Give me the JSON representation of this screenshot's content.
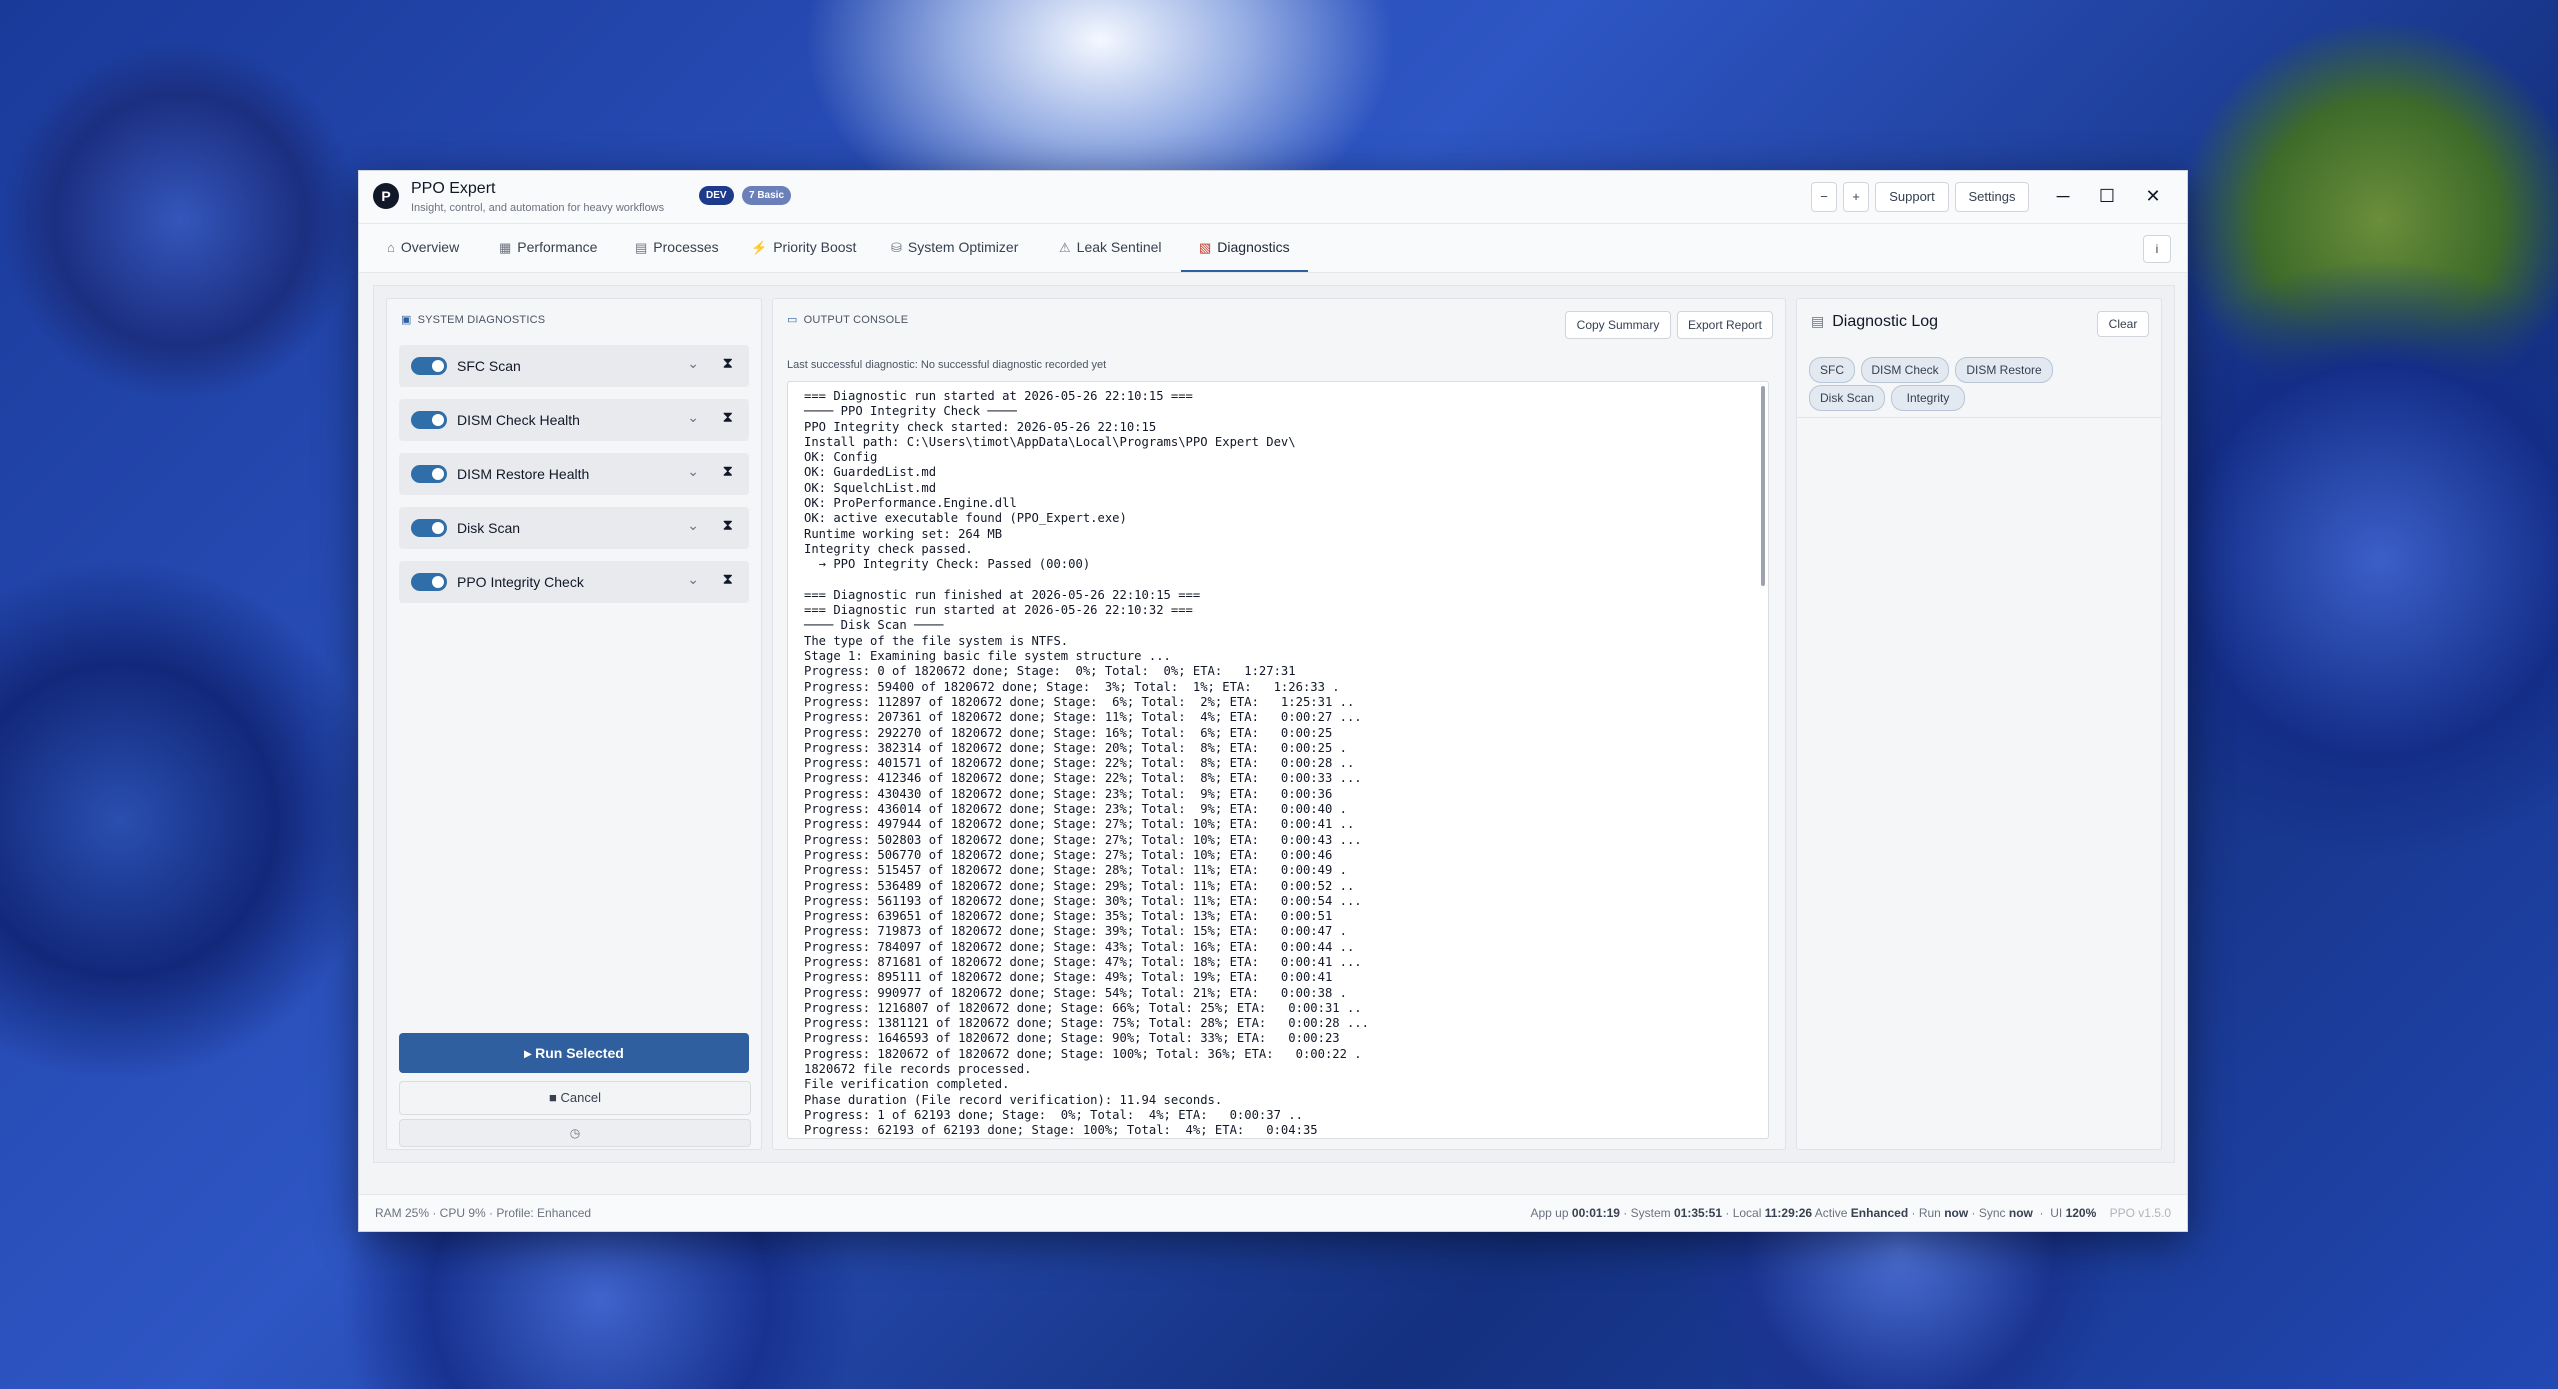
{
  "app": {
    "logo_letter": "P",
    "title": "PPO Expert",
    "subtitle": "Insight, control, and automation for heavy workflows",
    "badges": [
      "DEV",
      "7 Basic"
    ]
  },
  "titlebar": {
    "zoom_out": "−",
    "zoom_in": "+",
    "support": "Support",
    "settings": "Settings",
    "minimize": "─",
    "maximize": "☐",
    "close": "✕"
  },
  "tabs": [
    {
      "label": "Overview",
      "icon": "⌂"
    },
    {
      "label": "Performance",
      "icon": "▦"
    },
    {
      "label": "Processes",
      "icon": "▤"
    },
    {
      "label": "Priority Boost",
      "icon": "⚡"
    },
    {
      "label": "System Optimizer",
      "icon": "⛁"
    },
    {
      "label": "Leak Sentinel",
      "icon": "⚠"
    },
    {
      "label": "Diagnostics",
      "icon": "▧"
    }
  ],
  "info_label": "i",
  "left_panel": {
    "header": "SYSTEM DIAGNOSTICS",
    "items": [
      {
        "label": "SFC Scan",
        "enabled": true
      },
      {
        "label": "DISM Check Health",
        "enabled": true
      },
      {
        "label": "DISM Restore Health",
        "enabled": true
      },
      {
        "label": "Disk Scan",
        "enabled": true
      },
      {
        "label": "PPO Integrity Check",
        "enabled": true
      }
    ],
    "run_label": "▸  Run Selected",
    "cancel_label": "■  Cancel",
    "aux_label": "◷"
  },
  "console": {
    "header": "OUTPUT CONSOLE",
    "copy_label": "Copy Summary",
    "export_label": "Export Report",
    "last_diagnostic": "Last successful diagnostic: No successful diagnostic recorded yet",
    "lines": [
      "=== Diagnostic run started at 2026-05-26 22:10:15 ===",
      "──── PPO Integrity Check ────",
      "PPO Integrity check started: 2026-05-26 22:10:15",
      "Install path: C:\\Users\\timot\\AppData\\Local\\Programs\\PPO Expert Dev\\",
      "OK: Config",
      "OK: GuardedList.md",
      "OK: SquelchList.md",
      "OK: ProPerformance.Engine.dll",
      "OK: active executable found (PPO_Expert.exe)",
      "Runtime working set: 264 MB",
      "Integrity check passed.",
      "  → PPO Integrity Check: Passed (00:00)",
      "",
      "=== Diagnostic run finished at 2026-05-26 22:10:15 ===",
      "=== Diagnostic run started at 2026-05-26 22:10:32 ===",
      "──── Disk Scan ────",
      "The type of the file system is NTFS.",
      "Stage 1: Examining basic file system structure ...",
      "Progress: 0 of 1820672 done; Stage:  0%; Total:  0%; ETA:   1:27:31",
      "Progress: 59400 of 1820672 done; Stage:  3%; Total:  1%; ETA:   1:26:33 .",
      "Progress: 112897 of 1820672 done; Stage:  6%; Total:  2%; ETA:   1:25:31 ..",
      "Progress: 207361 of 1820672 done; Stage: 11%; Total:  4%; ETA:   0:00:27 ...",
      "Progress: 292270 of 1820672 done; Stage: 16%; Total:  6%; ETA:   0:00:25",
      "Progress: 382314 of 1820672 done; Stage: 20%; Total:  8%; ETA:   0:00:25 .",
      "Progress: 401571 of 1820672 done; Stage: 22%; Total:  8%; ETA:   0:00:28 ..",
      "Progress: 412346 of 1820672 done; Stage: 22%; Total:  8%; ETA:   0:00:33 ...",
      "Progress: 430430 of 1820672 done; Stage: 23%; Total:  9%; ETA:   0:00:36",
      "Progress: 436014 of 1820672 done; Stage: 23%; Total:  9%; ETA:   0:00:40 .",
      "Progress: 497944 of 1820672 done; Stage: 27%; Total: 10%; ETA:   0:00:41 ..",
      "Progress: 502803 of 1820672 done; Stage: 27%; Total: 10%; ETA:   0:00:43 ...",
      "Progress: 506770 of 1820672 done; Stage: 27%; Total: 10%; ETA:   0:00:46",
      "Progress: 515457 of 1820672 done; Stage: 28%; Total: 11%; ETA:   0:00:49 .",
      "Progress: 536489 of 1820672 done; Stage: 29%; Total: 11%; ETA:   0:00:52 ..",
      "Progress: 561193 of 1820672 done; Stage: 30%; Total: 11%; ETA:   0:00:54 ...",
      "Progress: 639651 of 1820672 done; Stage: 35%; Total: 13%; ETA:   0:00:51",
      "Progress: 719873 of 1820672 done; Stage: 39%; Total: 15%; ETA:   0:00:47 .",
      "Progress: 784097 of 1820672 done; Stage: 43%; Total: 16%; ETA:   0:00:44 ..",
      "Progress: 871681 of 1820672 done; Stage: 47%; Total: 18%; ETA:   0:00:41 ...",
      "Progress: 895111 of 1820672 done; Stage: 49%; Total: 19%; ETA:   0:00:41",
      "Progress: 990977 of 1820672 done; Stage: 54%; Total: 21%; ETA:   0:00:38 .",
      "Progress: 1216807 of 1820672 done; Stage: 66%; Total: 25%; ETA:   0:00:31 ..",
      "Progress: 1381121 of 1820672 done; Stage: 75%; Total: 28%; ETA:   0:00:28 ...",
      "Progress: 1646593 of 1820672 done; Stage: 90%; Total: 33%; ETA:   0:00:23",
      "Progress: 1820672 of 1820672 done; Stage: 100%; Total: 36%; ETA:   0:00:22 .",
      "1820672 file records processed.",
      "File verification completed.",
      "Phase duration (File record verification): 11.94 seconds.",
      "Progress: 1 of 62193 done; Stage:  0%; Total:  4%; ETA:   0:00:37 ..",
      "Progress: 62193 of 62193 done; Stage: 100%; Total:  4%; ETA:   0:04:35"
    ]
  },
  "log_panel": {
    "title": "Diagnostic Log",
    "clear_label": "Clear",
    "chips": [
      "SFC",
      "DISM Check",
      "DISM Restore",
      "Disk Scan",
      "Integrity"
    ]
  },
  "status": {
    "left": "RAM 25%  ·  CPU 9%  ·  Profile: Enhanced",
    "app_up_label": "App up",
    "app_up": "00:01:19",
    "system_label": "System",
    "system": "01:35:51",
    "local_label": "Local",
    "local": "11:29:26",
    "active_label": "Active",
    "active": "Enhanced",
    "run_label": "Run",
    "run": "now",
    "sync_label": "Sync",
    "sync": "now",
    "ui_label": "UI",
    "ui": "120%",
    "version": "PPO v1.5.0"
  },
  "colors": {
    "accent": "#2f5f9e",
    "toggle_on": "#2f6ea8",
    "badge_dev": "#1e3a8a",
    "badge_basic": "#6b7fb8"
  }
}
